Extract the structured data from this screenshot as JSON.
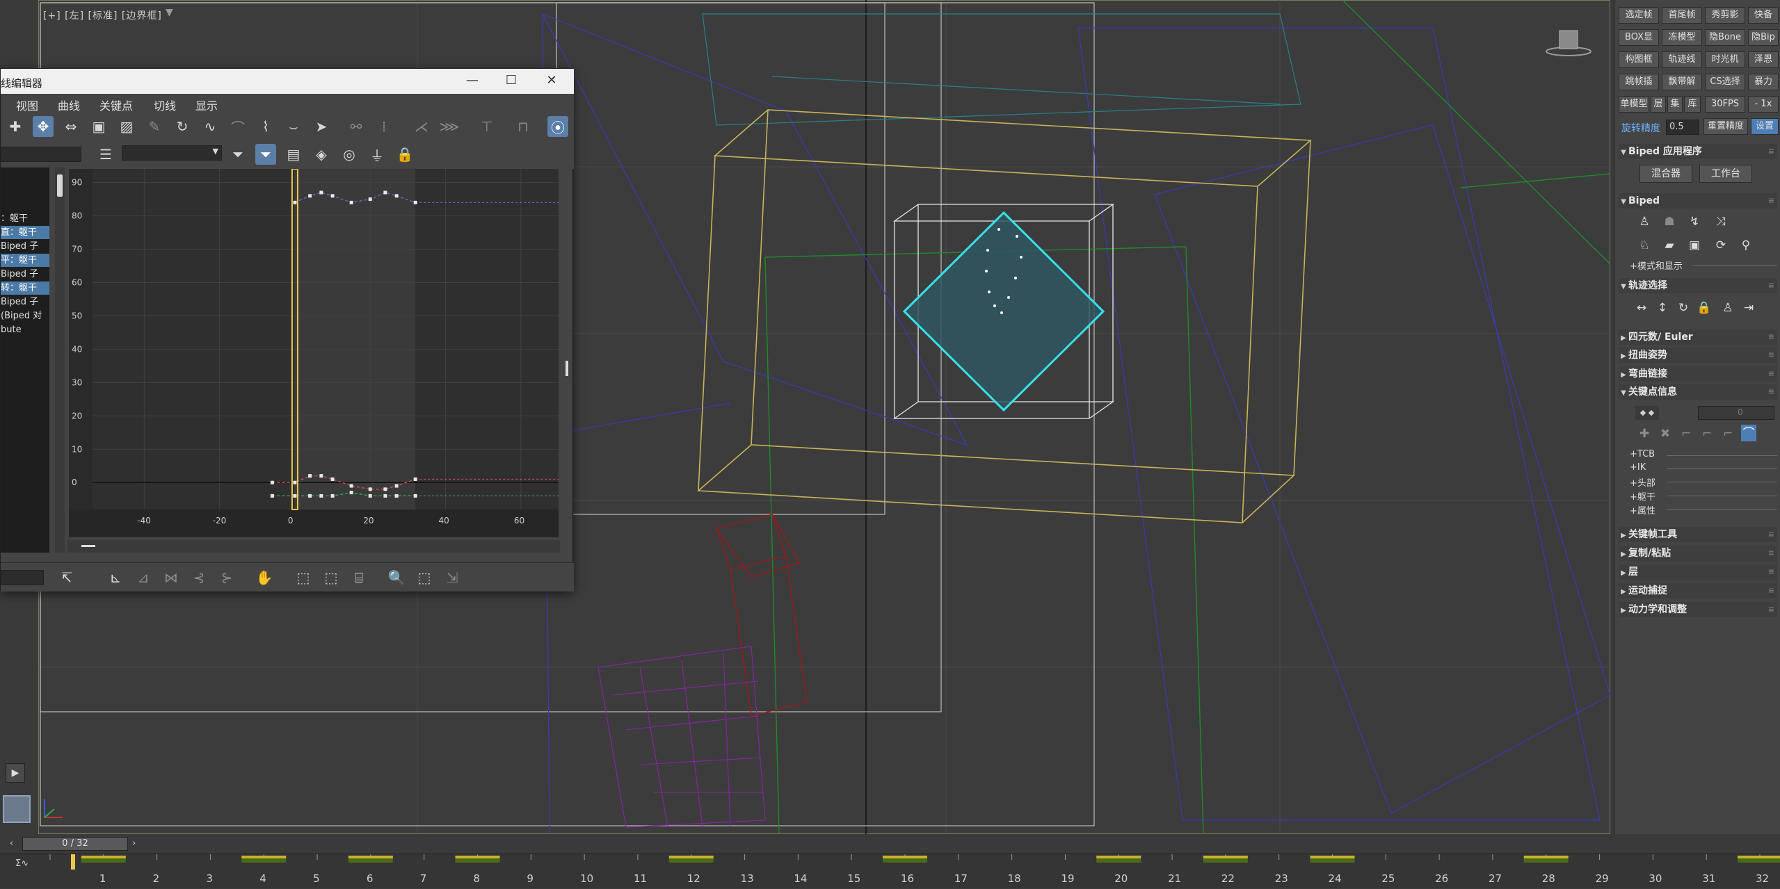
{
  "viewport": {
    "label": "[+] [左] [标准] [边界框]",
    "filter_icon": "funnel-icon",
    "axis_tripod_icon": "axis-tripod-icon",
    "play_icon": "play-triangle-icon"
  },
  "curve_editor": {
    "title": "线编辑器",
    "window_controls": [
      "minimize-icon",
      "maximize-icon",
      "close-icon"
    ],
    "menu": [
      "视图",
      "曲线",
      "关键点",
      "切线",
      "显示"
    ],
    "tree": [
      {
        "label": "：躯干",
        "selected": false
      },
      {
        "label": "直：躯干",
        "selected": true
      },
      {
        "label": "Biped 子",
        "selected": false
      },
      {
        "label": "平：躯干",
        "selected": true
      },
      {
        "label": "Biped 子",
        "selected": false
      },
      {
        "label": "转：躯干",
        "selected": true
      },
      {
        "label": "Biped 子",
        "selected": false
      },
      {
        "label": "(Biped 对",
        "selected": false
      },
      {
        "label": "bute",
        "selected": false
      }
    ],
    "y_axis": {
      "min": 0,
      "max": 90,
      "ticks": [
        0,
        10,
        20,
        30,
        40,
        50,
        60,
        70,
        80,
        90
      ]
    },
    "x_axis": {
      "min": -60,
      "max": 70,
      "tick_labels": [
        "-40",
        "-20",
        "0",
        "20",
        "40",
        "60"
      ],
      "tick_values": [
        -40,
        -20,
        0,
        20,
        40,
        60
      ]
    },
    "current_frame": 0,
    "active_range": [
      0,
      32
    ],
    "series": [
      {
        "color": "#6a6ae0",
        "points": [
          [
            0,
            84
          ],
          [
            4,
            86
          ],
          [
            7,
            87
          ],
          [
            10,
            86
          ],
          [
            15,
            84
          ],
          [
            20,
            85
          ],
          [
            24,
            87
          ],
          [
            27,
            86
          ],
          [
            32,
            84
          ]
        ]
      },
      {
        "color": "#e05050",
        "points": [
          [
            -6,
            0
          ],
          [
            0,
            0
          ],
          [
            4,
            2
          ],
          [
            7,
            2
          ],
          [
            10,
            1
          ],
          [
            15,
            -1
          ],
          [
            20,
            -2
          ],
          [
            24,
            -2
          ],
          [
            27,
            -1
          ],
          [
            32,
            1
          ]
        ]
      },
      {
        "color": "#40b060",
        "points": [
          [
            -6,
            -4
          ],
          [
            0,
            -4
          ],
          [
            4,
            -4
          ],
          [
            7,
            -4
          ],
          [
            10,
            -4
          ],
          [
            15,
            -3
          ],
          [
            20,
            -4
          ],
          [
            24,
            -4
          ],
          [
            27,
            -4
          ],
          [
            32,
            -4
          ]
        ]
      }
    ],
    "colors": {
      "selected_row": "#4c7aa6",
      "active_button": "#5b7fa8",
      "time_bar": "#e8c84a"
    }
  },
  "right_panel": {
    "quick_buttons": [
      [
        "选定帧",
        "首尾帧",
        "秀剪影",
        "快备"
      ],
      [
        "BOX显",
        "冻模型",
        "隐Bone",
        "隐Bip"
      ],
      [
        "构图框",
        "轨迹线",
        "时光机",
        "泽恩"
      ],
      [
        "跳帧插",
        "飘带解",
        "CS选择",
        "暴力"
      ],
      [
        "单模型",
        "层",
        "集",
        "库",
        "30FPS",
        "- 1x"
      ]
    ],
    "rotation_precision_label": "旋转精度",
    "rotation_precision_value": "0.5",
    "reset_precision": "重置精度",
    "settings_button": "设置",
    "rollouts": {
      "biped_app": "Biped 应用程序",
      "mixer": "混合器",
      "workbench": "工作台",
      "biped": "Biped",
      "mode_display": "+模式和显示",
      "track_selection": "轨迹选择",
      "quaternion_euler": "四元数/ Euler",
      "twist_pose": "扭曲姿势",
      "bend_link": "弯曲链接",
      "key_info": "关键点信息",
      "key_info_value": "0",
      "key_sub": [
        "+TCB",
        "+IK",
        "+头部",
        "+躯干",
        "+属性"
      ],
      "keyframe_tools": "关键帧工具",
      "copy_paste": "复制/粘贴",
      "layers": "层",
      "motion_capture": "运动捕捉",
      "dynamics": "动力学和调整"
    }
  },
  "timeline": {
    "frame_display": "0 / 32",
    "prev_icon": "chevron-left-icon",
    "next_icon": "chevron-right-icon",
    "ticks": [
      "1",
      "2",
      "3",
      "4",
      "5",
      "6",
      "7",
      "8",
      "9",
      "10",
      "11",
      "12",
      "13",
      "14",
      "15",
      "16",
      "17",
      "18",
      "19",
      "20",
      "21",
      "22",
      "23",
      "24",
      "25",
      "26",
      "27",
      "28",
      "29",
      "30",
      "31",
      "32"
    ],
    "key_frames": [
      1,
      4,
      6,
      8,
      12,
      16,
      20,
      22,
      24,
      28,
      32
    ],
    "start_frame": 0,
    "end_frame": 32
  }
}
